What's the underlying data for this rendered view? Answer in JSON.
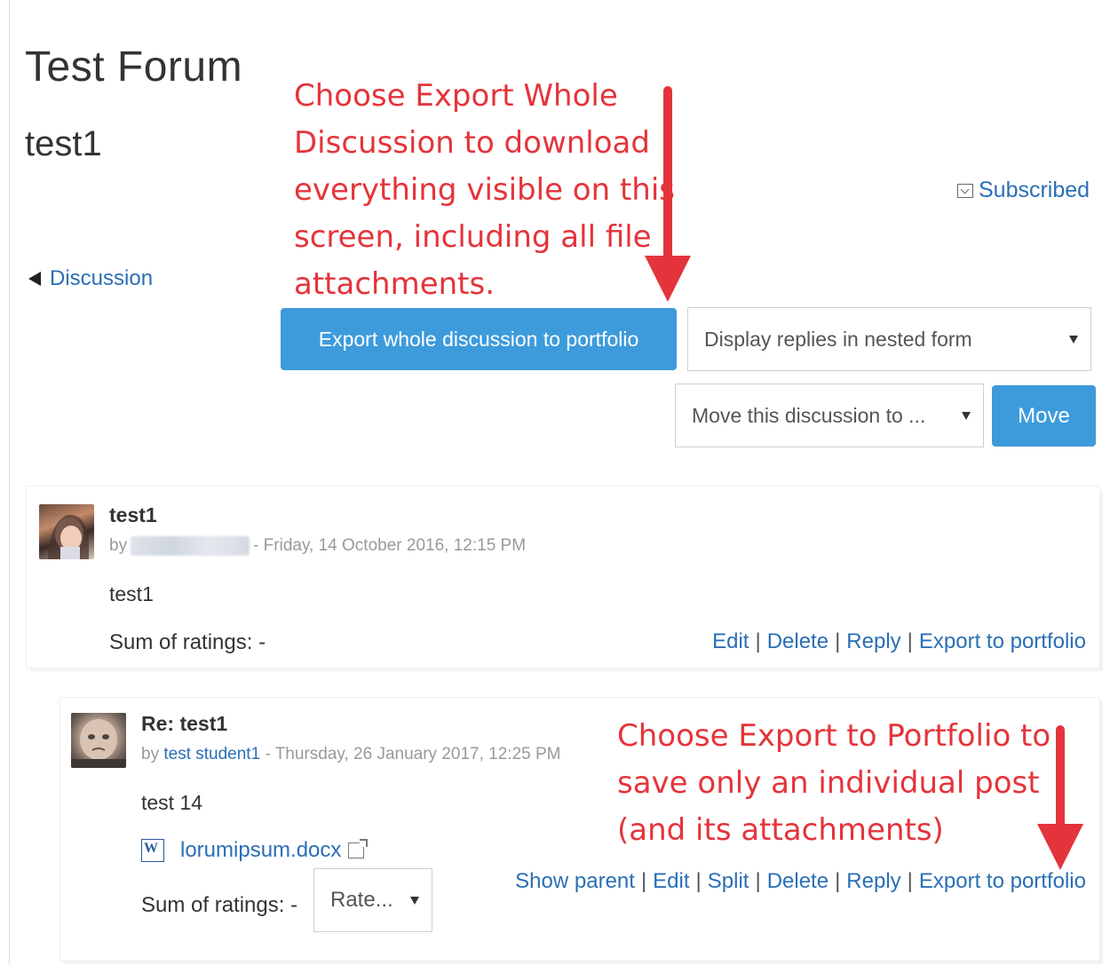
{
  "forum_title": "Test Forum",
  "discussion_name": "test1",
  "annotations": {
    "top": [
      "Choose Export Whole",
      "Discussion to download",
      "everything visible on this",
      "screen, including all file",
      "attachments."
    ],
    "bottom": [
      "Choose Export to Portfolio to",
      "save only an individual post",
      "(and its attachments)"
    ]
  },
  "colors": {
    "annotation": "#e4343b",
    "link": "#2a6fb5",
    "primary_button": "#3d9bdb"
  },
  "subscribed": {
    "label": "Subscribed",
    "icon": "checkbox-icon"
  },
  "nav": {
    "back_label": "Discussion",
    "icon": "left-triangle-icon"
  },
  "controls": {
    "export_whole": "Export whole discussion to portfolio",
    "display_mode": "Display replies in nested form",
    "move_select": "Move this discussion to ...",
    "move_button": "Move"
  },
  "posts": [
    {
      "subject": "test1",
      "by": "by",
      "date": "- Friday, 14 October 2016, 12:15 PM",
      "body": "test1",
      "ratings": "Sum of ratings: -",
      "commands": [
        "Edit",
        "Delete",
        "Reply",
        "Export to portfolio"
      ]
    },
    {
      "subject": "Re: test1",
      "by": "by",
      "author": "test student1",
      "date": "- Thursday, 26 January 2017, 12:25 PM",
      "body": "test 14",
      "attachment": "lorumipsum.docx",
      "ratings": "Sum of ratings: -",
      "rate_placeholder": "Rate...",
      "commands": [
        "Show parent",
        "Edit",
        "Split",
        "Delete",
        "Reply",
        "Export to portfolio"
      ]
    }
  ],
  "separator": "|"
}
